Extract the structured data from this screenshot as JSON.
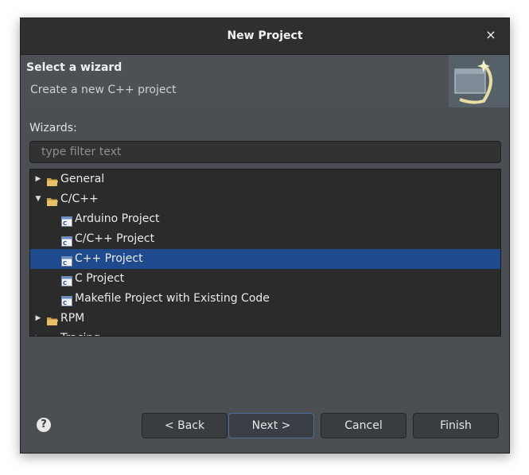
{
  "window": {
    "title": "New Project",
    "close_glyph": "×"
  },
  "banner": {
    "title": "Select a wizard",
    "description": "Create a new C++ project"
  },
  "wizards_label": "Wizards:",
  "filter": {
    "placeholder": "type filter text",
    "value": ""
  },
  "tree": [
    {
      "label": "General",
      "type": "folder",
      "expanded": false,
      "depth": 0
    },
    {
      "label": "C/C++",
      "type": "folder",
      "expanded": true,
      "depth": 0
    },
    {
      "label": "Arduino Project",
      "type": "project",
      "depth": 1
    },
    {
      "label": "C/C++ Project",
      "type": "project",
      "depth": 1
    },
    {
      "label": "C++ Project",
      "type": "project",
      "depth": 1,
      "selected": true
    },
    {
      "label": "C Project",
      "type": "project",
      "depth": 1
    },
    {
      "label": "Makefile Project with Existing Code",
      "type": "project",
      "depth": 1
    },
    {
      "label": "RPM",
      "type": "folder",
      "expanded": false,
      "depth": 0
    },
    {
      "label": "Tracing",
      "type": "folder",
      "expanded": false,
      "depth": 0
    }
  ],
  "buttons": {
    "back": "< Back",
    "next": "Next >",
    "cancel": "Cancel",
    "finish": "Finish"
  },
  "help_glyph": "?",
  "colors": {
    "selection": "#1f4b8e",
    "dialog_bg": "#4b4f53",
    "tree_bg": "#2b2b2b"
  }
}
